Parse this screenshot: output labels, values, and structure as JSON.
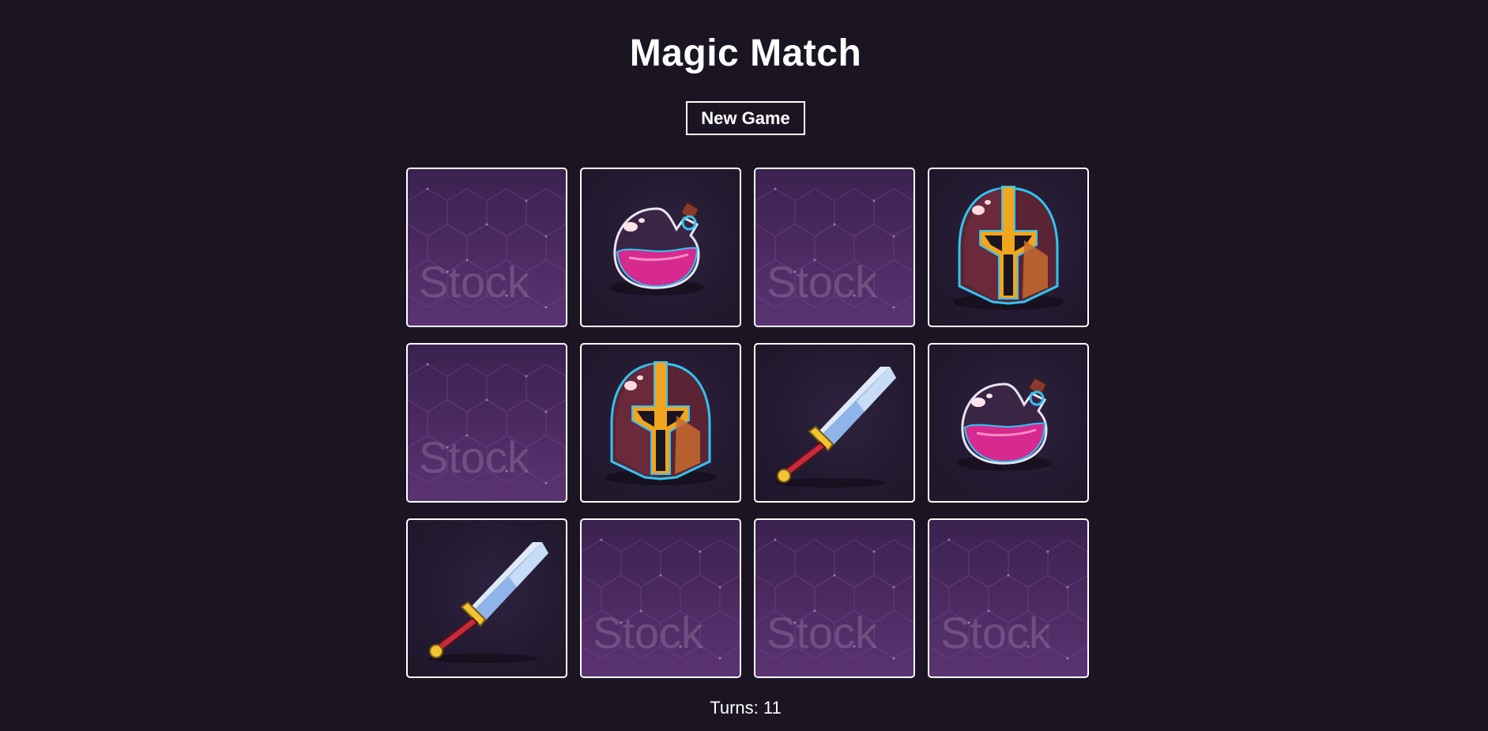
{
  "title": "Magic Match",
  "new_game_label": "New Game",
  "turns": {
    "label": "Turns:",
    "value": "11"
  },
  "card_back_watermark": "Stock",
  "cards": [
    {
      "state": "back",
      "icon": "card-back-icon"
    },
    {
      "state": "face",
      "icon": "potion-icon"
    },
    {
      "state": "back",
      "icon": "card-back-icon"
    },
    {
      "state": "face",
      "icon": "helmet-icon"
    },
    {
      "state": "back",
      "icon": "card-back-icon"
    },
    {
      "state": "face",
      "icon": "helmet-icon"
    },
    {
      "state": "face",
      "icon": "sword-icon"
    },
    {
      "state": "face",
      "icon": "potion-icon"
    },
    {
      "state": "face",
      "icon": "sword-icon"
    },
    {
      "state": "back",
      "icon": "card-back-icon"
    },
    {
      "state": "back",
      "icon": "card-back-icon"
    },
    {
      "state": "back",
      "icon": "card-back-icon"
    }
  ],
  "colors": {
    "background": "#1b1523",
    "card_border": "#ffffff",
    "card_back": "#4e2b61",
    "potion": "#d62a8f",
    "helmet_gold": "#f2a51e",
    "sword_blade": "#8fb4e8"
  }
}
